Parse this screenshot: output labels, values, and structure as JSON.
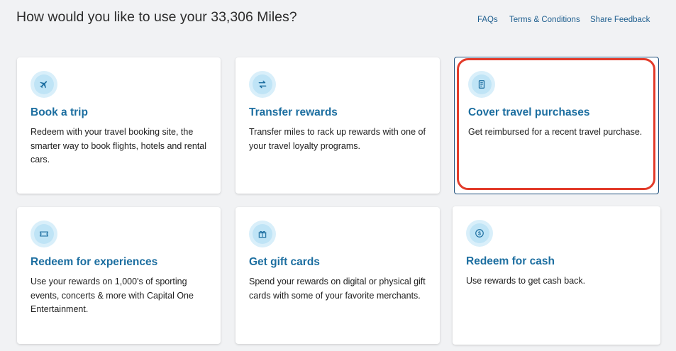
{
  "header": {
    "title": "How would you like to use your 33,306 Miles?",
    "links": [
      "FAQs",
      "Terms & Conditions",
      "Share Feedback"
    ]
  },
  "cards": [
    {
      "title": "Book a trip",
      "description": "Redeem with your travel booking site, the smarter way to book flights, hotels and rental cars.",
      "icon": "airplane-icon"
    },
    {
      "title": "Transfer rewards",
      "description": "Transfer miles to rack up rewards with one of your travel loyalty programs.",
      "icon": "transfer-arrows-icon"
    },
    {
      "title": "Cover travel purchases",
      "description": "Get reimbursed for a recent travel purchase.",
      "icon": "receipt-icon",
      "selected": true
    },
    {
      "title": "Redeem for experiences",
      "description": "Use your rewards on 1,000's of sporting events, concerts & more with Capital One Entertainment.",
      "icon": "ticket-icon"
    },
    {
      "title": "Get gift cards",
      "description": "Spend your rewards on digital or physical gift cards with some of your favorite merchants.",
      "icon": "gift-icon"
    },
    {
      "title": "Redeem for cash",
      "description": "Use rewards to get cash back.",
      "icon": "dollar-coin-icon"
    }
  ],
  "colors": {
    "background": "#f1f2f4",
    "card_title": "#1c6ea0",
    "link": "#1f5f8f",
    "selected_border": "#1d4f7c",
    "annotation_highlight": "#e23b2a"
  }
}
